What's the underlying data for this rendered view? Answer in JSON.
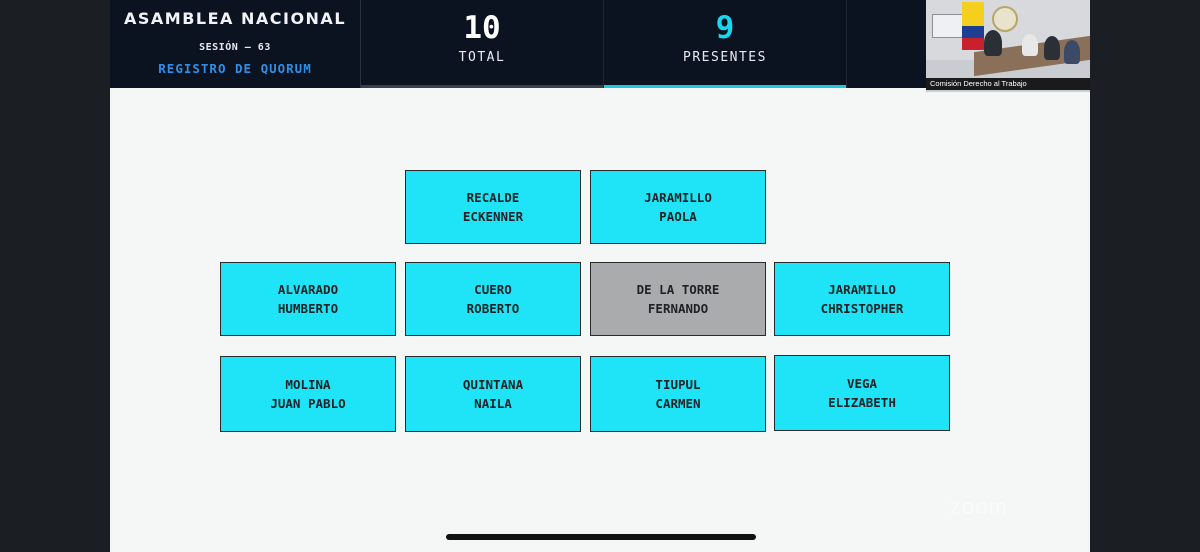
{
  "header": {
    "title": "ASAMBLEA NACIONAL",
    "session": "SESIÓN — 63",
    "subtitle": "REGISTRO DE QUORUM"
  },
  "stats": {
    "total": {
      "value": "10",
      "label": "TOTAL",
      "color": "#ffffff"
    },
    "present": {
      "value": "9",
      "label": "PRESENTES",
      "color": "#19d6ec"
    }
  },
  "video": {
    "caption": "Comisión Derecho al Trabajo"
  },
  "members": [
    {
      "line1": "RECALDE",
      "line2": "ECKENNER",
      "status": "present"
    },
    {
      "line1": "JARAMILLO",
      "line2": "PAOLA",
      "status": "present"
    },
    {
      "line1": "ALVARADO",
      "line2": "HUMBERTO",
      "status": "present"
    },
    {
      "line1": "CUERO",
      "line2": "ROBERTO",
      "status": "present"
    },
    {
      "line1": "DE LA TORRE",
      "line2": "FERNANDO",
      "status": "absent"
    },
    {
      "line1": "JARAMILLO",
      "line2": "CHRISTOPHER",
      "status": "present"
    },
    {
      "line1": "MOLINA",
      "line2": "JUAN PABLO",
      "status": "present"
    },
    {
      "line1": "QUINTANA",
      "line2": "NAILA",
      "status": "present"
    },
    {
      "line1": "TIUPUL",
      "line2": "CARMEN",
      "status": "present"
    },
    {
      "line1": "VEGA",
      "line2": "ELIZABETH",
      "status": "present"
    }
  ],
  "colors": {
    "present": "#1fe3f6",
    "absent": "#a9abac",
    "header_bg": "#0b1220",
    "accent": "#2f8fe6"
  },
  "watermark": "zoom"
}
